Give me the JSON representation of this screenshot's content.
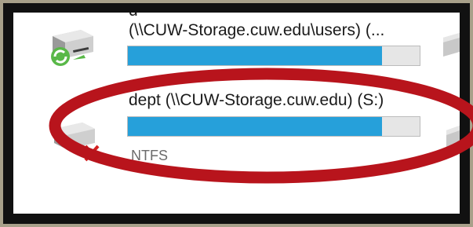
{
  "drives": [
    {
      "label": "(\\\\CUW-Storage.cuw.edu\\users) (...",
      "usage_fraction": 0.87,
      "status": "connected"
    },
    {
      "label": "dept (\\\\CUW-Storage.cuw.edu) (S:)",
      "usage_fraction": 0.87,
      "status": "disconnected",
      "filesystem": "NTFS"
    }
  ],
  "colors": {
    "bar_fill": "#26a0da",
    "annotation_ellipse": "#b8141c",
    "frame_outer": "#a8a08a",
    "frame_inner": "#111111"
  },
  "icons": {
    "connected_drive": "network-drive-sync-icon",
    "disconnected_drive": "network-drive-disconnected-icon"
  }
}
